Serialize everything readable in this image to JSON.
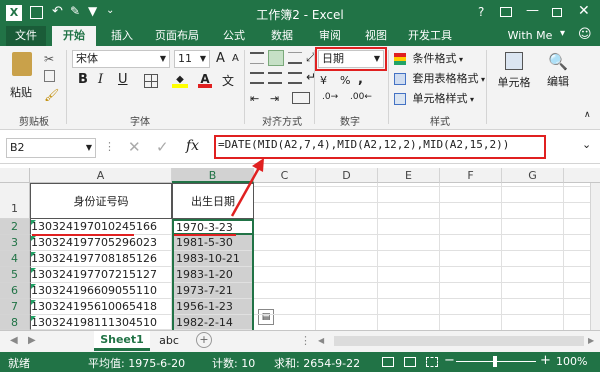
{
  "window": {
    "title": "工作簿2 - Excel",
    "help": "?"
  },
  "tabs": [
    "文件",
    "开始",
    "插入",
    "页面布局",
    "公式",
    "数据",
    "审阅",
    "视图",
    "开发工具"
  ],
  "account": "With Me",
  "ribbon": {
    "paste": "粘贴",
    "clipboard_group": "剪贴板",
    "font_name": "宋体",
    "font_size": "11",
    "font_group": "字体",
    "align_group": "对齐方式",
    "number_format": "日期",
    "number_group": "数字",
    "cond_format": "条件格式",
    "table_format": "套用表格格式",
    "cell_style": "单元格样式",
    "style_group": "样式",
    "cells": "单元格",
    "edit": "编辑",
    "bold": "B",
    "italic": "I",
    "underline": "U",
    "font_grow": "A",
    "font_shrink": "A",
    "percent": "%",
    "comma": ","
  },
  "formula_bar": {
    "name_box": "B2",
    "fx": "fx",
    "formula": "=DATE(MID(A2,7,4),MID(A2,12,2),MID(A2,15,2))"
  },
  "columns": [
    "A",
    "B",
    "C",
    "D",
    "E",
    "F",
    "G"
  ],
  "rows": [
    "1",
    "2",
    "3",
    "4",
    "5",
    "6",
    "7",
    "8"
  ],
  "headers": {
    "a1": "身份证号码",
    "b1": "出生日期"
  },
  "data": [
    {
      "id": "130324197010245166",
      "date": "1970-3-23"
    },
    {
      "id": "130324197705296023",
      "date": "1981-5-30"
    },
    {
      "id": "130324197708185126",
      "date": "1983-10-21"
    },
    {
      "id": "130324197707215127",
      "date": "1983-1-20"
    },
    {
      "id": "130324196609055110",
      "date": "1973-7-21"
    },
    {
      "id": "130324195610065418",
      "date": "1956-1-23"
    },
    {
      "id": "130324198111304510",
      "date": "1982-2-14"
    }
  ],
  "sheets": [
    "Sheet1",
    "abc"
  ],
  "status": {
    "ready": "就绪",
    "average": "平均值: 1975-6-20",
    "count": "计数: 10",
    "sum": "求和: 2654-9-22",
    "zoom": "100%"
  },
  "colors": {
    "excel_green": "#217346",
    "highlight_red": "#e02020",
    "selection_gray": "#d0d0d0"
  }
}
